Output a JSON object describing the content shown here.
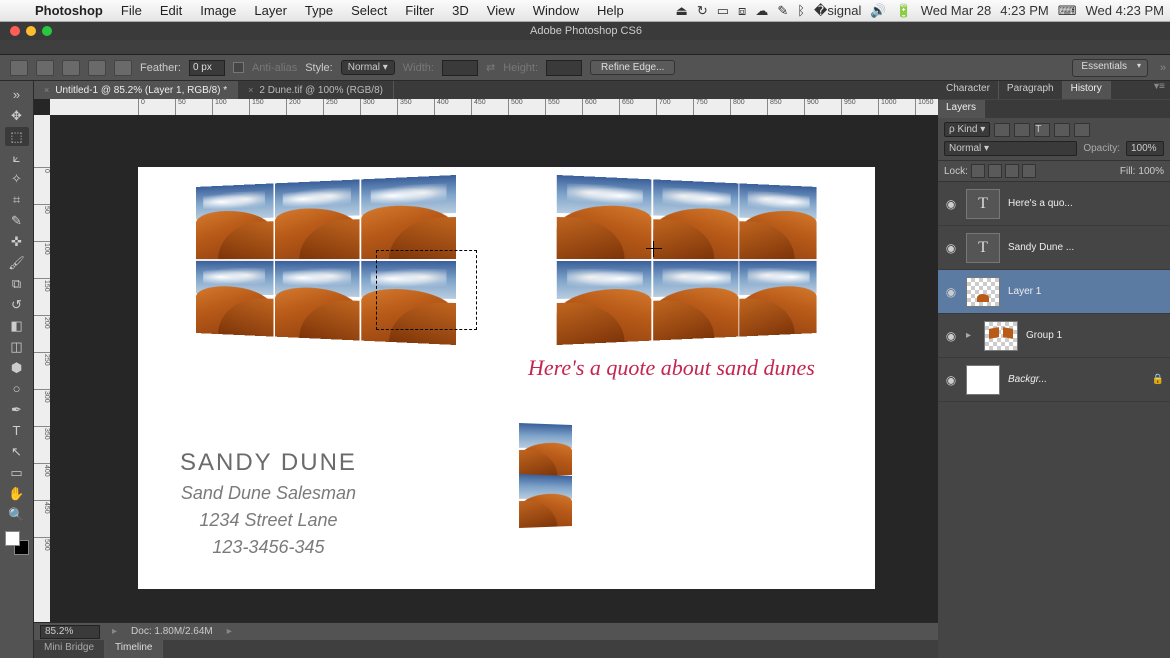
{
  "mac_menu": {
    "app": "Photoshop",
    "items": [
      "File",
      "Edit",
      "Image",
      "Layer",
      "Type",
      "Select",
      "Filter",
      "3D",
      "View",
      "Window",
      "Help"
    ],
    "status_date": "Wed Mar 28",
    "status_time": "4:23 PM",
    "status_time2": "Wed 4:23 PM"
  },
  "titlebar": {
    "title": "Adobe Photoshop CS6"
  },
  "options": {
    "feather_label": "Feather:",
    "feather_value": "0 px",
    "antialias_label": "Anti-alias",
    "style_label": "Style:",
    "style_value": "Normal",
    "width_label": "Width:",
    "height_label": "Height:",
    "refine_label": "Refine Edge...",
    "workspace": "Essentials"
  },
  "doc_tabs": {
    "active": "Untitled-1 @ 85.2% (Layer 1, RGB/8) *",
    "other": "2 Dune.tif @ 100% (RGB/8)"
  },
  "ruler_h": [
    "0",
    "50",
    "100",
    "150",
    "200",
    "250",
    "300",
    "350",
    "400",
    "450",
    "500",
    "550",
    "600",
    "650",
    "700",
    "750",
    "800",
    "850",
    "900",
    "950",
    "1000",
    "1050"
  ],
  "ruler_v": [
    "0",
    "50",
    "100",
    "150",
    "200",
    "250",
    "300",
    "350",
    "400",
    "450",
    "500"
  ],
  "canvas": {
    "quote": "Here's a quote about sand dunes",
    "name": "SANDY DUNE",
    "role": "Sand Dune Salesman",
    "address": "1234 Street Lane",
    "phone": "123-3456-345"
  },
  "status": {
    "zoom": "85.2%",
    "doc": "Doc: 1.80M/2.64M"
  },
  "bottom_tabs": {
    "mini_bridge": "Mini Bridge",
    "timeline": "Timeline"
  },
  "panels": {
    "group1": [
      "Character",
      "Paragraph",
      "History"
    ],
    "layers_tab": "Layers",
    "kind": "Kind",
    "blend": "Normal",
    "opacity_label": "Opacity:",
    "opacity_val": "100%",
    "lock_label": "Lock:",
    "fill_label": "Fill:",
    "fill_val": "100%",
    "layers": [
      {
        "name": "Here's a quo...",
        "type": "text"
      },
      {
        "name": "Sandy Dune ...",
        "type": "text"
      },
      {
        "name": "Layer 1",
        "type": "trans",
        "selected": true
      },
      {
        "name": "Group 1",
        "type": "group"
      },
      {
        "name": "Backgr...",
        "type": "white",
        "locked": true
      }
    ]
  }
}
